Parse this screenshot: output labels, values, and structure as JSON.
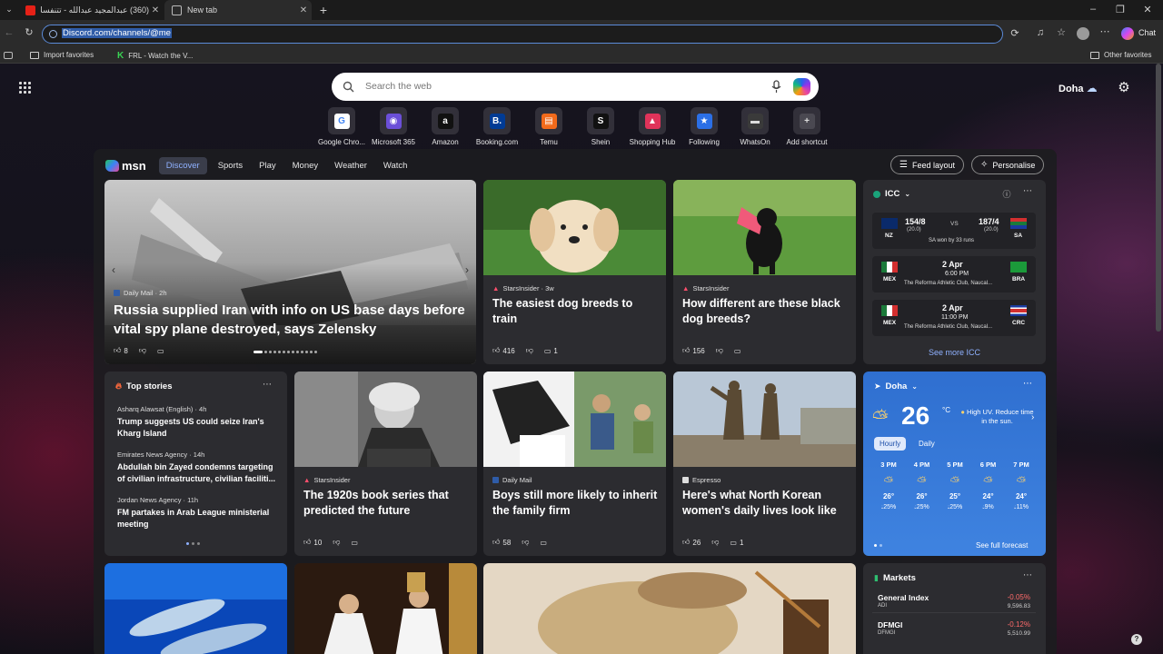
{
  "browser": {
    "tabs": [
      {
        "title": "(360) عبدالمجيد عبدالله - تتنفسك دا"
      },
      {
        "title": "New tab"
      }
    ],
    "new_tab_label": "+",
    "url": "Discord.com/channels/@me",
    "chat_label": "Chat",
    "bookmarks": [
      {
        "label": "Import favorites"
      },
      {
        "label": "FRL - Watch the V..."
      }
    ],
    "other_favorites": "Other favorites"
  },
  "ntp": {
    "search_placeholder": "Search the web",
    "location": "Doha",
    "shortcuts": [
      {
        "label": "Google Chro...",
        "glyph": "G",
        "color": "#ffffff",
        "fg": "#4285f4"
      },
      {
        "label": "Microsoft 365",
        "glyph": "◉",
        "color": "#6b4fd8",
        "fg": "#ffffff"
      },
      {
        "label": "Amazon",
        "glyph": "a",
        "color": "#111111",
        "fg": "#ffffff"
      },
      {
        "label": "Booking.com",
        "glyph": "B.",
        "color": "#003b95",
        "fg": "#ffffff"
      },
      {
        "label": "Temu",
        "glyph": "▤",
        "color": "#f26a1b",
        "fg": "#ffffff"
      },
      {
        "label": "Shein",
        "glyph": "S",
        "color": "#111111",
        "fg": "#ffffff"
      },
      {
        "label": "Shopping Hub",
        "glyph": "▲",
        "color": "#e0335a",
        "fg": "#ffffff"
      },
      {
        "label": "Following",
        "glyph": "★",
        "color": "#2b6fe6",
        "fg": "#ffffff"
      },
      {
        "label": "WhatsOn",
        "glyph": "▬",
        "color": "#3a3a3a",
        "fg": "#dddddd"
      },
      {
        "label": "Add shortcut",
        "glyph": "+",
        "color": "rgba(255,255,255,0.12)",
        "fg": "#dddddd"
      }
    ]
  },
  "feed": {
    "logo": "msn",
    "nav": [
      "Discover",
      "Sports",
      "Play",
      "Money",
      "Weather",
      "Watch"
    ],
    "feed_layout": "Feed layout",
    "personalise": "Personalise",
    "hero": {
      "source": "Daily Mail · 2h",
      "headline": "Russia supplied Iran with info on US base days before vital spy plane destroyed, says Zelensky",
      "likes": "8"
    },
    "card_dogs": {
      "source": "StarsInsider · 3w",
      "headline": "The easiest dog breeds to train",
      "likes": "416",
      "comments": "1"
    },
    "card_blackdog": {
      "source": "StarsInsider",
      "headline": "How different are these black dog breeds?",
      "likes": "156"
    },
    "icc": {
      "title": "ICC",
      "match1": {
        "team1": "NZ",
        "score1": "154/8",
        "overs1": "(20.0)",
        "vs": "VS",
        "team2": "SA",
        "score2": "187/4",
        "overs2": "(20.0)",
        "result": "SA won by 33 runs"
      },
      "match2": {
        "team1": "MEX",
        "date": "2 Apr",
        "time": "6:00 PM",
        "venue": "The Reforma Athletic Club, Naucal...",
        "team2": "BRA"
      },
      "match3": {
        "team1": "MEX",
        "date": "2 Apr",
        "time": "11:00 PM",
        "venue": "The Reforma Athletic Club, Naucal...",
        "team2": "CRC"
      },
      "see_more": "See more ICC"
    },
    "top_stories": {
      "title": "Top stories",
      "items": [
        {
          "source": "Asharq Alawsat (English) · 4h",
          "headline": "Trump suggests US could seize Iran's Kharg Island"
        },
        {
          "source": "Emirates News Agency · 14h",
          "headline": "Abdullah bin Zayed condemns targeting of civilian infrastructure, civilian faciliti..."
        },
        {
          "source": "Jordan News Agency · 11h",
          "headline": "FM partakes in Arab League ministerial meeting"
        }
      ]
    },
    "card_einstein": {
      "source": "StarsInsider",
      "headline": "The 1920s book series that predicted the future",
      "likes": "10"
    },
    "card_family": {
      "source": "Daily Mail",
      "headline": "Boys still more likely to inherit the family firm",
      "likes": "58"
    },
    "card_korea": {
      "source": "Espresso",
      "headline": "Here's what North Korean women's daily lives look like",
      "likes": "26",
      "comments": "1"
    },
    "weather": {
      "location": "Doha",
      "temp": "26",
      "unit": "°C",
      "alert": "High UV. Reduce time in the sun.",
      "tab_hourly": "Hourly",
      "tab_daily": "Daily",
      "hours": [
        {
          "time": "3 PM",
          "temp": "26°",
          "rain": "25%"
        },
        {
          "time": "4 PM",
          "temp": "26°",
          "rain": "25%"
        },
        {
          "time": "5 PM",
          "temp": "25°",
          "rain": "25%"
        },
        {
          "time": "6 PM",
          "temp": "24°",
          "rain": "9%"
        },
        {
          "time": "7 PM",
          "temp": "24°",
          "rain": "11%"
        }
      ],
      "see_full": "See full forecast"
    },
    "markets": {
      "title": "Markets",
      "rows": [
        {
          "name": "General Index",
          "sub": "ADI",
          "change": "-0.05%",
          "value": "9,596.83"
        },
        {
          "name": "DFMGI",
          "sub": "DFMGI",
          "change": "-0.12%",
          "value": "5,510.99"
        }
      ]
    }
  }
}
